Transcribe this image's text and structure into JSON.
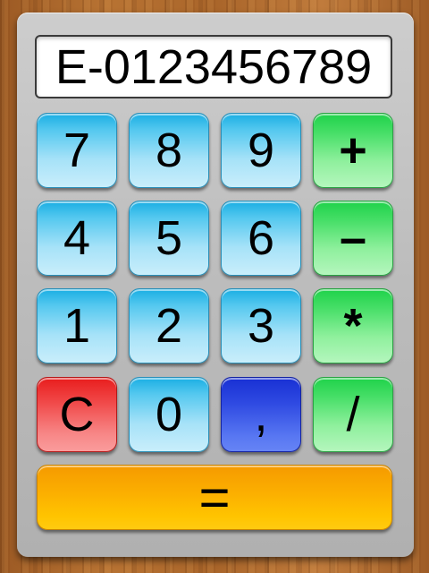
{
  "display": {
    "text": "E-0123456789"
  },
  "keys": {
    "seven": "7",
    "eight": "8",
    "nine": "9",
    "plus": "+",
    "four": "4",
    "five": "5",
    "six": "6",
    "minus": "–",
    "one": "1",
    "two": "2",
    "three": "3",
    "multiply": "*",
    "clear": "C",
    "zero": "0",
    "comma": ",",
    "divide": "/",
    "equals": "="
  },
  "colors": {
    "digit_key": "#54c8ef",
    "operator_key": "#45de66",
    "clear_key": "#f04444",
    "comma_key": "#2f4ae2",
    "equals_key": "#fcb000",
    "frame": "#bcbcbc",
    "display_background": "#ffffff"
  }
}
